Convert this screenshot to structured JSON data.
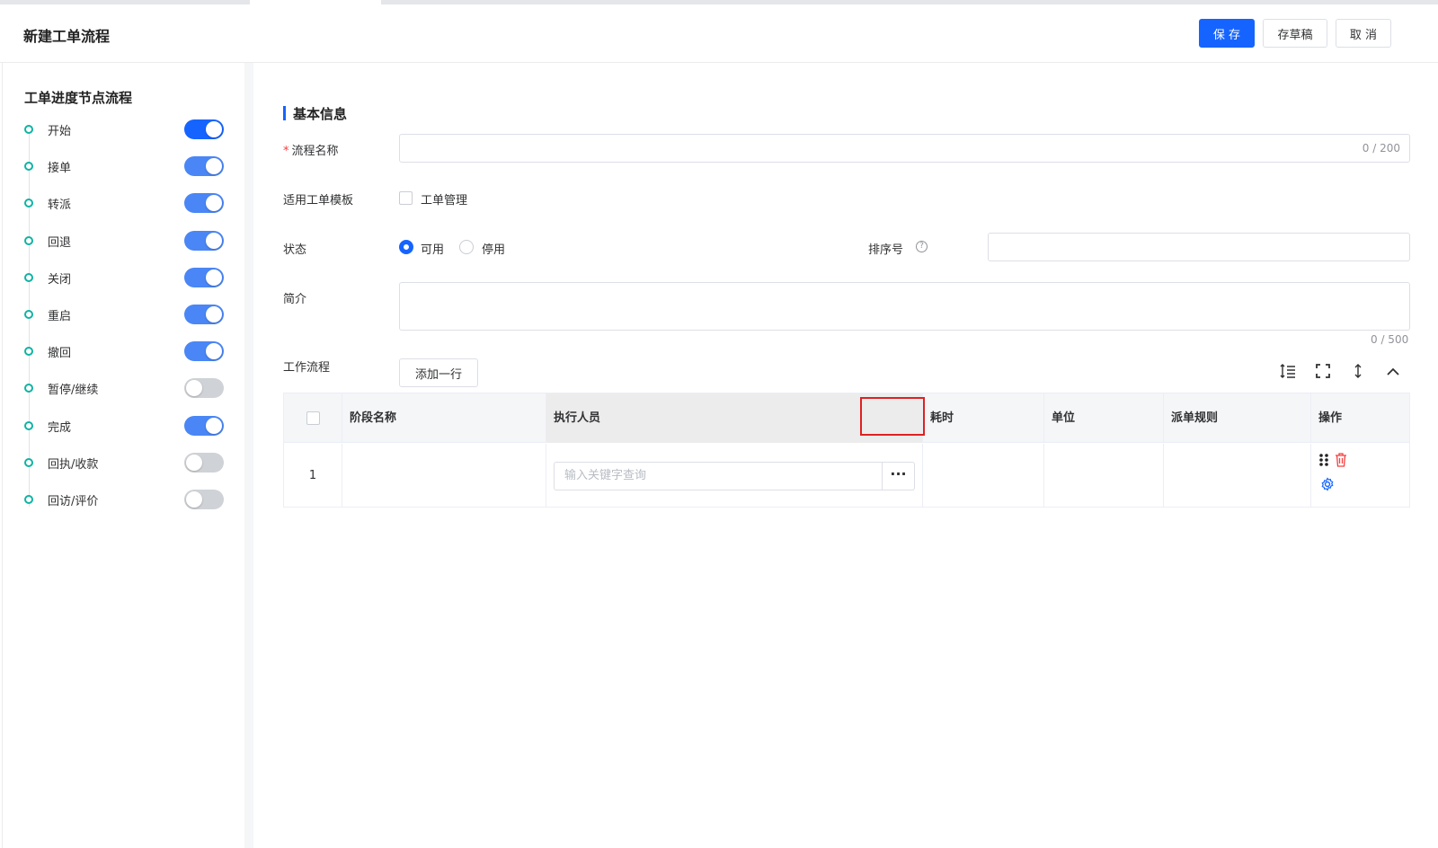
{
  "header": {
    "title": "新建工单流程",
    "buttons": {
      "save": "保 存",
      "draft": "存草稿",
      "cancel": "取 消"
    }
  },
  "sidebar": {
    "title": "工单进度节点流程",
    "nodes": [
      {
        "label": "开始",
        "enabled": true
      },
      {
        "label": "接单",
        "enabled": true
      },
      {
        "label": "转派",
        "enabled": true
      },
      {
        "label": "回退",
        "enabled": true
      },
      {
        "label": "关闭",
        "enabled": true
      },
      {
        "label": "重启",
        "enabled": true
      },
      {
        "label": "撤回",
        "enabled": true
      },
      {
        "label": "暂停/继续",
        "enabled": false
      },
      {
        "label": "完成",
        "enabled": true
      },
      {
        "label": "回执/收款",
        "enabled": false
      },
      {
        "label": "回访/评价",
        "enabled": false
      }
    ]
  },
  "form": {
    "section_title": "基本信息",
    "name": {
      "required_mark": "*",
      "label": "流程名称",
      "value": "",
      "counter": "0 / 200"
    },
    "template": {
      "label": "适用工单模板",
      "option": "工单管理",
      "checked": false
    },
    "status": {
      "label": "状态",
      "options": [
        "可用",
        "停用"
      ],
      "selected": "可用"
    },
    "sort": {
      "label": "排序号",
      "help_icon": "question-circle-icon",
      "value": ""
    },
    "intro": {
      "label": "简介",
      "value": "",
      "counter": "0 / 500"
    },
    "workflow": {
      "label": "工作流程",
      "add_row": "添加一行"
    }
  },
  "toolbar_icons": [
    "line-height-icon",
    "fullscreen-icon",
    "row-height-icon",
    "collapse-up-icon"
  ],
  "table": {
    "columns": [
      "",
      "阶段名称",
      "执行人员",
      "",
      "耗时",
      "单位",
      "派单规则",
      "操作"
    ],
    "rows": [
      {
        "index": "1",
        "stage": "",
        "executor_placeholder": "输入关键字查询",
        "more": "···",
        "duration": "",
        "unit": "",
        "rule": ""
      }
    ]
  },
  "colors": {
    "primary": "#1664ff",
    "accent_dot": "#10b3a3",
    "danger": "#f53f3f"
  }
}
